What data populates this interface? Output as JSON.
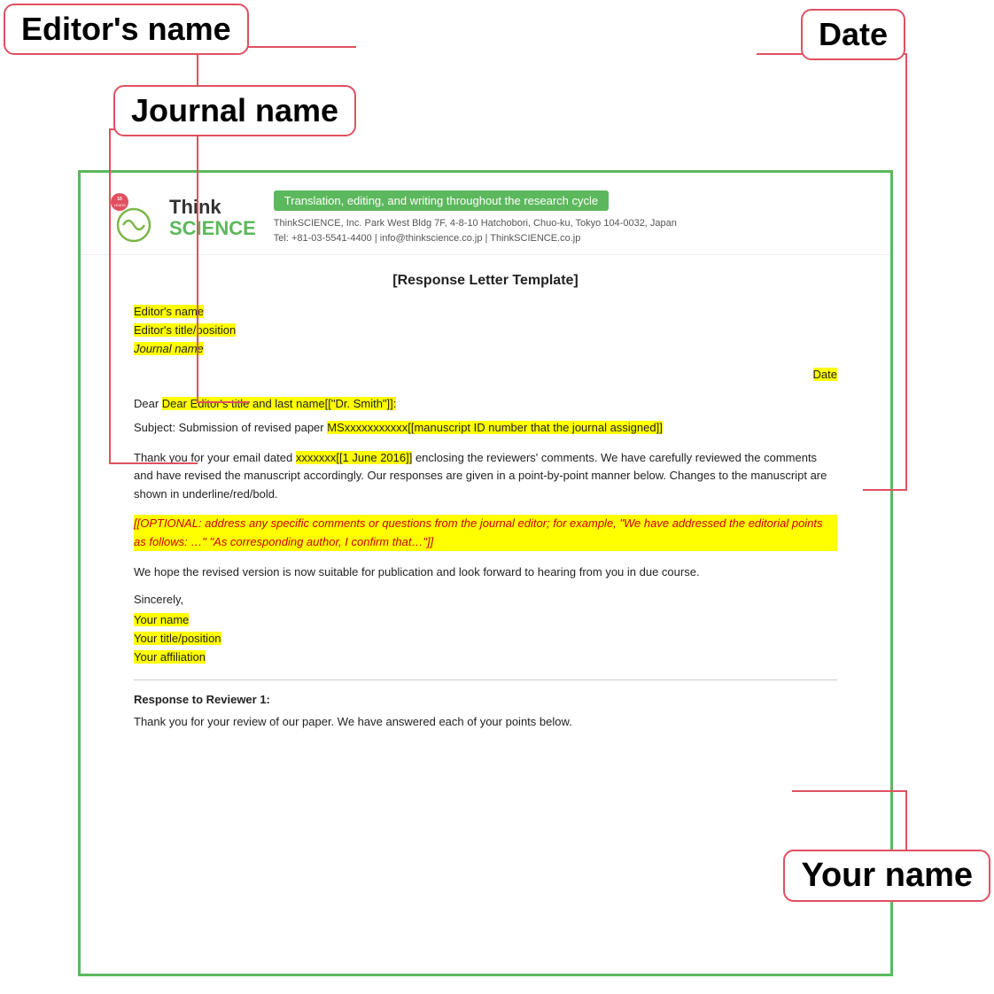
{
  "annotations": {
    "editors_name_label": "Editor's name",
    "date_label": "Date",
    "journal_name_label": "Journal name",
    "your_name_label": "Your name"
  },
  "header": {
    "logo_years": "10 YEARS",
    "logo_line1": "Think",
    "logo_line2": "SCIENCE",
    "tagline": "Translation, editing, and writing throughout the research cycle",
    "contact_line1": "ThinkSCIENCE, Inc.   Park West Bldg 7F, 4-8-10 Hatchobori, Chuo-ku, Tokyo 104-0032, Japan",
    "contact_line2": "Tel: +81-03-5541-4400 | info@thinkscience.co.jp | ThinkSCIENCE.co.jp"
  },
  "document": {
    "title": "[Response Letter Template]",
    "field_editors_name": "Editor's name",
    "field_editors_title": "Editor's title/position",
    "field_journal_name": "Journal name",
    "field_date": "Date",
    "dear_line": "Dear Editor's title and last name[[\"Dr. Smith\"]]:",
    "subject_prefix": "Subject:  Submission of revised paper  ",
    "subject_highlight": "MSxxxxxxxxxxx[[manuscript ID number that the journal assigned]]",
    "para1_start": "Thank you for your email dated ",
    "para1_date": "xxxxxxx[[1 June 2016]]",
    "para1_rest": " enclosing the reviewers' comments. We have carefully reviewed the comments and have revised the manuscript accordingly. Our responses are given in a point-by-point manner below. Changes to the manuscript are shown in underline/red/bold.",
    "optional_text": "[[OPTIONAL: address any specific comments or questions from the journal editor; for example, \"We have addressed the editorial points as follows: …\" \"As corresponding author, I confirm that…\"]]",
    "para2": "We hope the revised version is now suitable for publication and look forward to hearing from you in due course.",
    "sincerely": "Sincerely,",
    "your_name": "Your name",
    "your_title": "Your title/position",
    "your_affiliation": "Your affiliation",
    "response_title": "Response to Reviewer 1:",
    "response_para": "Thank you for your review of our paper. We have answered each of your points below."
  }
}
